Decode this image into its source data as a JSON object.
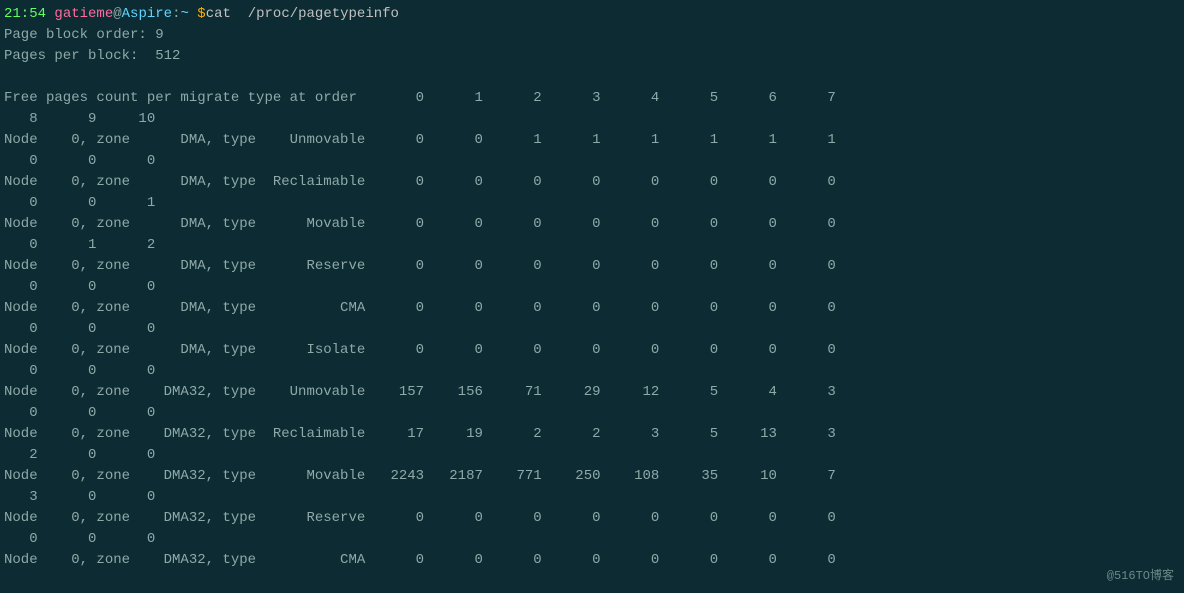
{
  "prompt": {
    "time": "21:54",
    "user": "gatieme",
    "at": "@",
    "host": "Aspire",
    "colon": ":",
    "path": "~",
    "dollar": " $",
    "cmd": "cat",
    "arg": "  /proc/pagetypeinfo"
  },
  "header": {
    "line1": "Page block order: 9",
    "line2": "Pages per block:  512"
  },
  "title_line1": "Free pages count per migrate type at order       0      1      2      3      4      5      6      7",
  "title_line2": "   8      9     10",
  "rows": [
    {
      "l1": "Node    0, zone      DMA, type    Unmovable      0      0      1      1      1      1      1      1",
      "l2": "   0      0      0"
    },
    {
      "l1": "Node    0, zone      DMA, type  Reclaimable      0      0      0      0      0      0      0      0",
      "l2": "   0      0      1"
    },
    {
      "l1": "Node    0, zone      DMA, type      Movable      0      0      0      0      0      0      0      0",
      "l2": "   0      1      2"
    },
    {
      "l1": "Node    0, zone      DMA, type      Reserve      0      0      0      0      0      0      0      0",
      "l2": "   0      0      0"
    },
    {
      "l1": "Node    0, zone      DMA, type          CMA      0      0      0      0      0      0      0      0",
      "l2": "   0      0      0"
    },
    {
      "l1": "Node    0, zone      DMA, type      Isolate      0      0      0      0      0      0      0      0",
      "l2": "   0      0      0"
    },
    {
      "l1": "Node    0, zone    DMA32, type    Unmovable    157    156     71     29     12      5      4      3",
      "l2": "   0      0      0"
    },
    {
      "l1": "Node    0, zone    DMA32, type  Reclaimable     17     19      2      2      3      5     13      3",
      "l2": "   2      0      0"
    },
    {
      "l1": "Node    0, zone    DMA32, type      Movable   2243   2187    771    250    108     35     10      7",
      "l2": "   3      0      0"
    },
    {
      "l1": "Node    0, zone    DMA32, type      Reserve      0      0      0      0      0      0      0      0",
      "l2": "   0      0      0"
    },
    {
      "l1": "Node    0, zone    DMA32, type          CMA      0      0      0      0      0      0      0      0",
      "l2": ""
    }
  ],
  "watermark": "@516TO博客"
}
